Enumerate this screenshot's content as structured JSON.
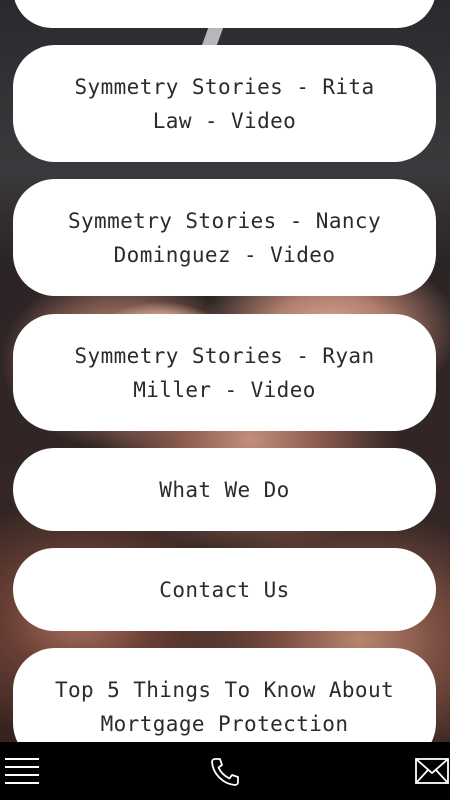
{
  "menu": {
    "items": [
      {
        "label": ""
      },
      {
        "label": "Symmetry Stories - Rita Law - Video"
      },
      {
        "label": "Symmetry Stories - Nancy Dominguez - Video"
      },
      {
        "label": "Symmetry Stories - Ryan Miller - Video"
      },
      {
        "label": "What We Do"
      },
      {
        "label": "Contact Us"
      },
      {
        "label": "Top 5 Things To Know About Mortgage Protection"
      }
    ]
  },
  "bottom_bar": {
    "menu_icon": "hamburger-menu-icon",
    "phone_icon": "phone-icon",
    "email_icon": "envelope-icon"
  },
  "colors": {
    "button_bg": "#ffffff",
    "button_text": "#2b2b2b",
    "bar_bg": "#000000"
  }
}
